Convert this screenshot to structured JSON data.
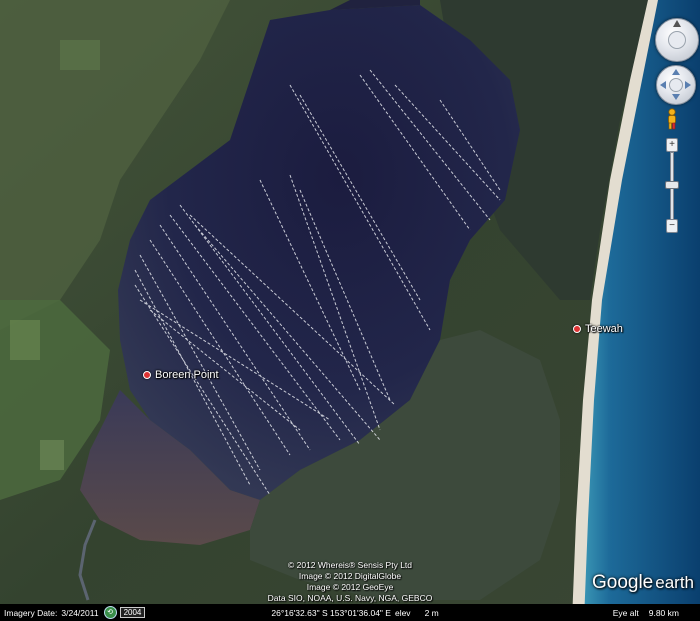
{
  "places": [
    {
      "name": "Boreen Point"
    },
    {
      "name": "Teewah"
    }
  ],
  "copyright": [
    "© 2012 Whereis® Sensis Pty Ltd",
    "Image © 2012 DigitalGlobe",
    "Image © 2012 GeoEye",
    "Data SIO, NOAA, U.S. Navy, NGA, GEBCO"
  ],
  "logo": {
    "google": "Google",
    "earth": "earth"
  },
  "status": {
    "imagery_label": "Imagery Date:",
    "imagery_date": "3/24/2011",
    "year": "2004",
    "coordinates": "26°16'32.63\" S  153°01'36.04\" E",
    "elev_label": "elev",
    "elev_value": "2 m",
    "eye_alt_label": "Eye alt",
    "eye_alt_value": "9.80 km"
  },
  "colors": {
    "water_dark": "#1a1c3d",
    "forest": "#2f3c2a",
    "ocean": "#0d4a7a",
    "beach": "#d8d2c4",
    "track": "#e8eaf0"
  }
}
